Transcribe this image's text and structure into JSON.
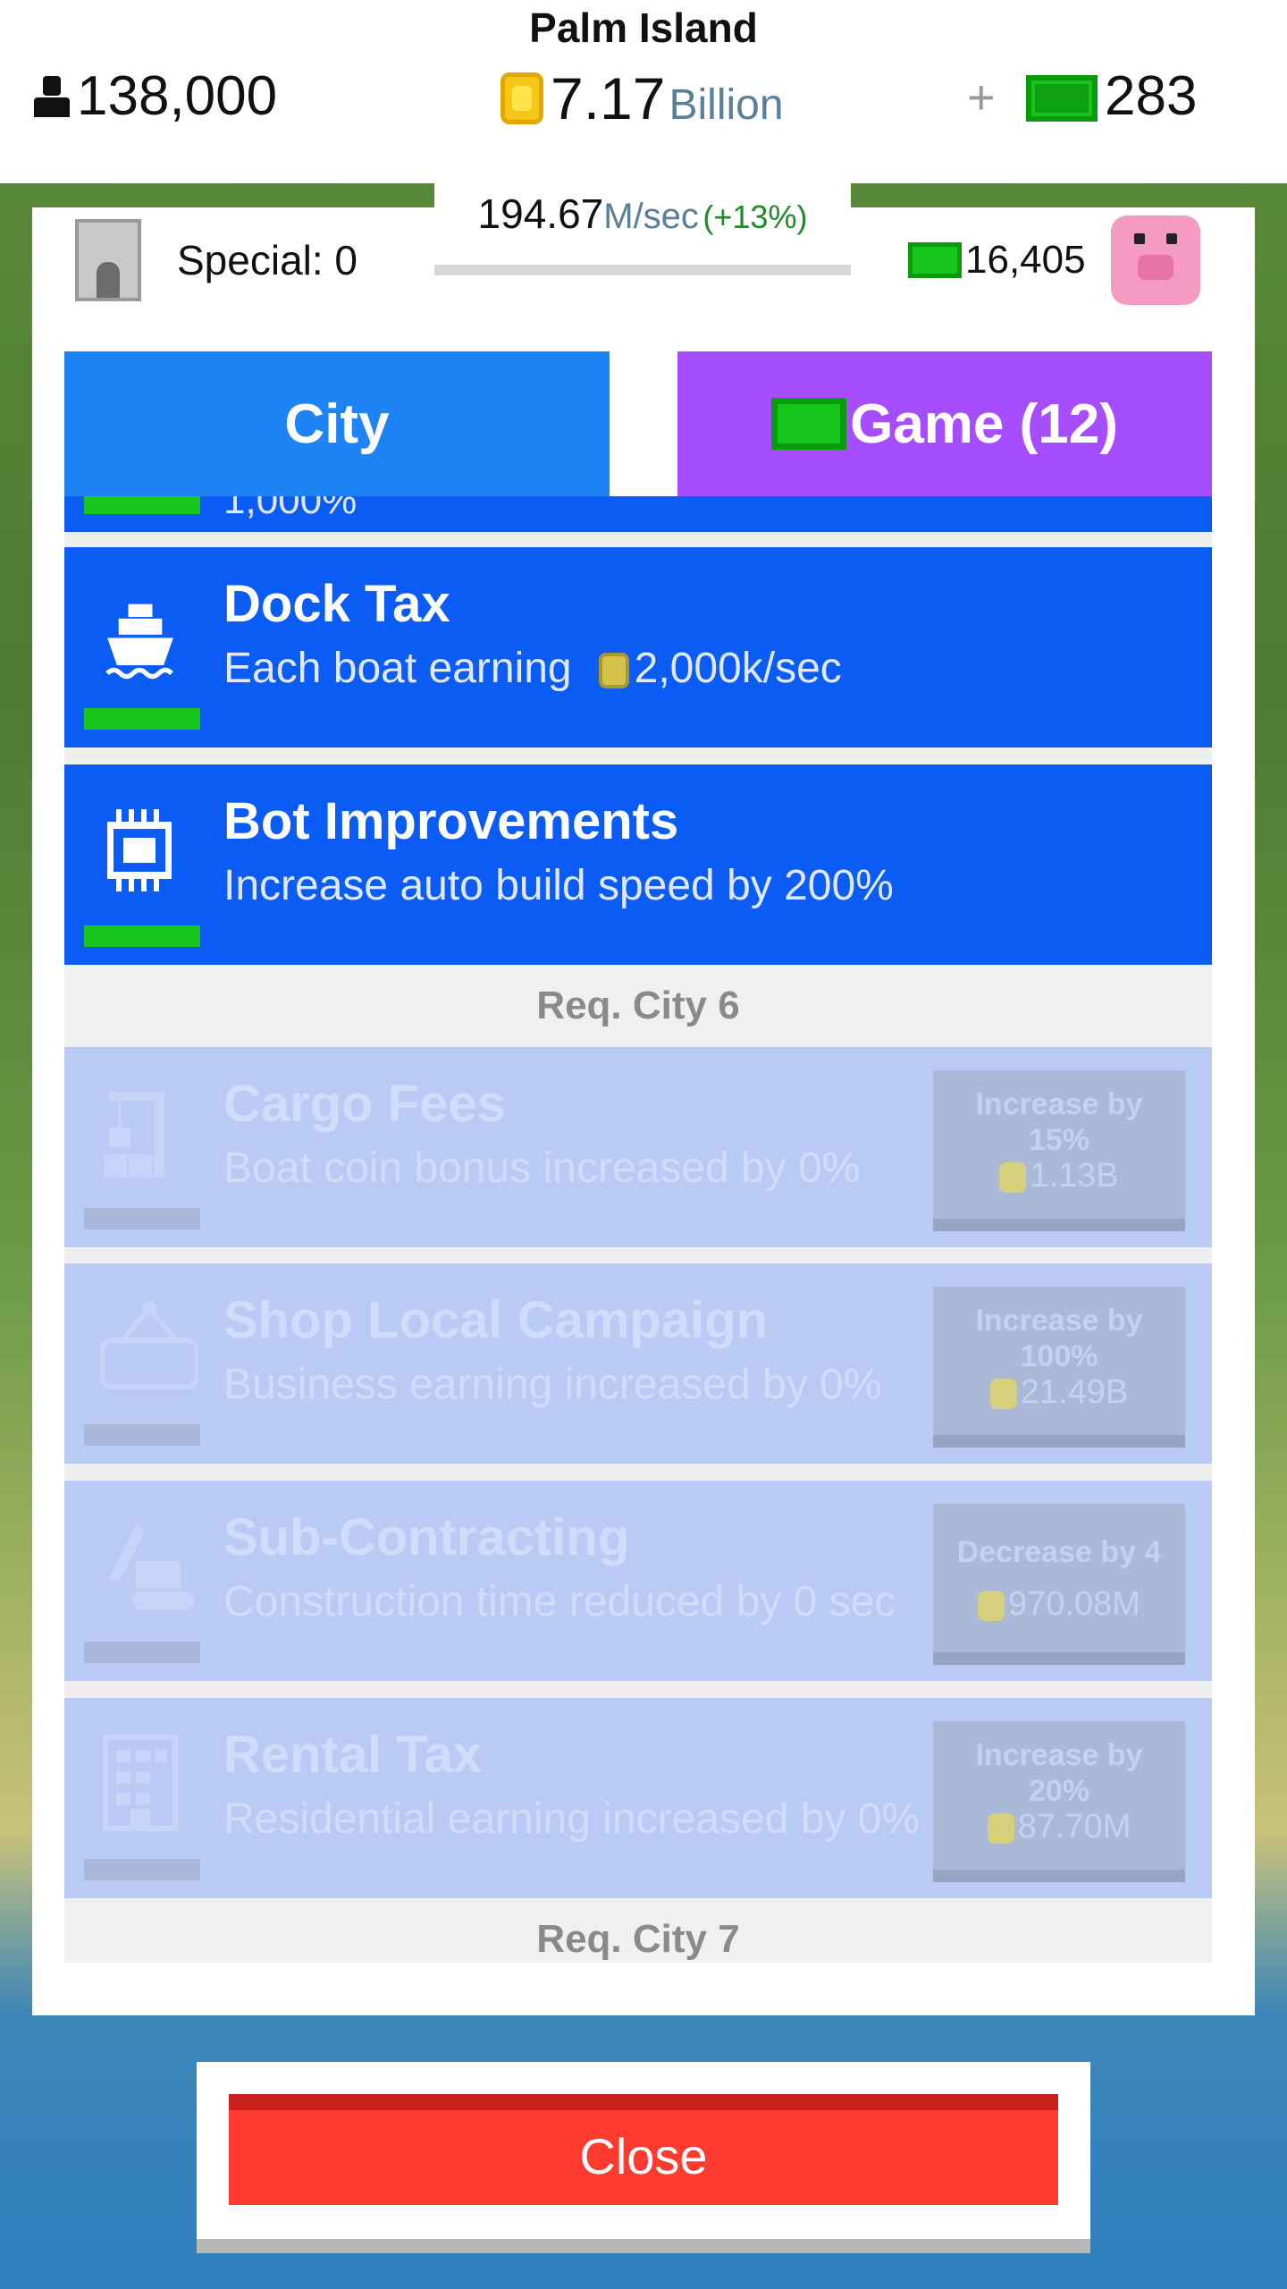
{
  "header": {
    "title": "Palm Island",
    "population": "138,000",
    "coins_value": "7.17",
    "coins_unit": "Billion",
    "plus_label": "+",
    "gems": "283"
  },
  "rate": {
    "value": "194.67",
    "unit": "M/sec",
    "percent": "(+13%)"
  },
  "special": {
    "label": "Special: 0"
  },
  "wallet": {
    "gems": "16,405"
  },
  "tabs": {
    "city": "City",
    "game": "Game (12)"
  },
  "list": {
    "partial_text": "1,000%",
    "items": [
      {
        "name": "Dock Tax",
        "desc_prefix": "Each boat earning",
        "desc_value": "2,000k/sec",
        "icon": "ship-icon"
      },
      {
        "name": "Bot Improvements",
        "desc": "Increase auto build speed by 200%",
        "icon": "chip-icon"
      }
    ],
    "req_city_6": "Req. City 6",
    "locked": [
      {
        "name": "Cargo Fees",
        "desc": "Boat coin bonus increased by 0%",
        "btn_line1": "Increase by",
        "btn_line2": "15%",
        "cost": "1.13B",
        "icon": "crane-icon"
      },
      {
        "name": "Shop Local Campaign",
        "desc": "Business earning increased by 0%",
        "btn_line1": "Increase by",
        "btn_line2": "100%",
        "cost": "21.49B",
        "icon": "open-sign-icon"
      },
      {
        "name": "Sub-Contracting",
        "desc": "Construction time reduced by 0 sec",
        "btn_line1": "Decrease by 4",
        "btn_line2": "",
        "cost": "970.08M",
        "icon": "excavator-icon"
      },
      {
        "name": "Rental Tax",
        "desc": "Residential earning increased by 0%",
        "btn_line1": "Increase by",
        "btn_line2": "20%",
        "cost": "87.70M",
        "icon": "building-icon"
      }
    ],
    "req_city_7": "Req. City 7"
  },
  "close": {
    "label": "Close"
  },
  "colors": {
    "upgrade_blue": "#0a5cf5",
    "tab_city": "#1e84f5",
    "tab_game": "#a64dff",
    "close_red": "#ff3b30",
    "gem_green": "#16c61a"
  }
}
